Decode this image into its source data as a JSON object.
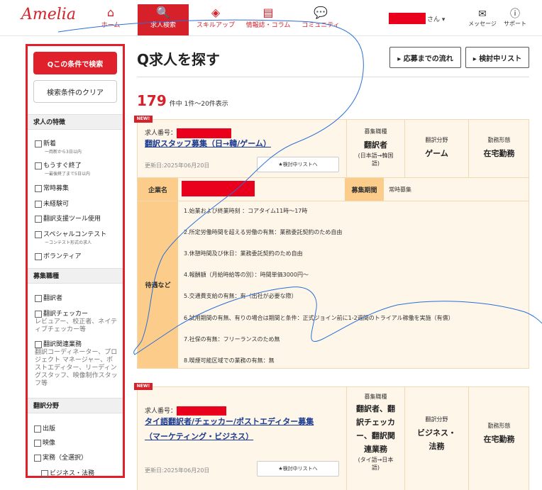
{
  "header": {
    "logo": "Amelia",
    "nav": [
      {
        "label": "ホーム",
        "icon": "home-icon",
        "glyph": "⌂"
      },
      {
        "label": "求人検索",
        "icon": "search-icon",
        "glyph": "🔍"
      },
      {
        "label": "スキルアップ",
        "icon": "layers-icon",
        "glyph": "◈"
      },
      {
        "label": "情報誌・コラム",
        "icon": "document-icon",
        "glyph": "▤"
      },
      {
        "label": "コミュニティ",
        "icon": "chat-icon",
        "glyph": "💬"
      }
    ],
    "user_suffix": "さん ▾",
    "message": {
      "label": "メッセージ",
      "glyph": "✉"
    },
    "support": {
      "label": "サポート",
      "glyph": "ⓘ"
    }
  },
  "sidebar": {
    "search_button": "Qこの条件で検索",
    "clear_button": "検索条件のクリア",
    "sections": [
      {
        "title": "求人の特徴"
      },
      {
        "title": "募集職種"
      },
      {
        "title": "翻訳分野"
      }
    ],
    "features": [
      {
        "label": "新着",
        "sub": "一両新から3日以内"
      },
      {
        "label": "もうすぐ終了",
        "sub": "一最後終了まで5日以内"
      },
      {
        "label": "常時募集",
        "sub": ""
      },
      {
        "label": "未経験可",
        "sub": ""
      },
      {
        "label": "翻訳支援ツール使用",
        "sub": ""
      },
      {
        "label": "スペシャルコンテスト",
        "sub": "ーコンテスト形式の求人"
      },
      {
        "label": "ボランティア",
        "sub": ""
      }
    ],
    "roles": [
      {
        "label": "翻訳者",
        "desc": ""
      },
      {
        "label": "翻訳チェッカー",
        "desc": "レビュアー、校正者、ネイティブチェッカー等"
      },
      {
        "label": "翻訳関連業務",
        "desc": "翻訳コーディネーター、プロジェクト マネージャー、ポストエディター、リーディングスタッフ、映像制作スタッフ等"
      }
    ],
    "fields": [
      {
        "label": "出版"
      },
      {
        "label": "映像"
      },
      {
        "label": "実務（全選択）"
      },
      {
        "label": "ビジネス・法務"
      }
    ]
  },
  "main": {
    "title": "Q求人を探す",
    "btn_flow": "▸ 応募までの流れ",
    "btn_list": "▸ 検討中リスト",
    "count_num": "179",
    "count_text": "件中 1件〜20件表示"
  },
  "jobs": [
    {
      "badge": "NEW!",
      "no_label": "求人番号：",
      "title_lines": [
        "翻訳スタッフ募集（日→韓/ゲーム）"
      ],
      "updated": "更新日:2025年06月20日",
      "fav": "★検討中リストへ",
      "role_label": "募集職種",
      "role_value": [
        "翻訳者"
      ],
      "role_sub": [
        "(日本語→韓国",
        "語)"
      ],
      "field_label": "翻訳分野",
      "field_value": [
        "ゲーム"
      ],
      "style_label": "勤務形態",
      "style_value": "在宅勤務",
      "company_label": "企業名",
      "period_label": "募集期間",
      "period_value": "常時募集",
      "terms_label": "待遇など",
      "terms": [
        "1.始業および終業時刻 ：コアタイム11時〜17時",
        "2.所定労働時間を超える労働の有無：業務委託契約のため自由",
        "3.休憩時間及び休日：業務委託契約のため自由",
        "4.報酬額（月給時給等の別）：時間単価3000円〜",
        "5.交通費支給の有無：有（出社が必要な際）",
        "6.試用期間の有無、有りの場合は期間と条件：正式ジョイン前に1-2週間のトライアル稼働を実施（有償）",
        "7.社保の有無：フリーランスのため無",
        "8.喫煙可能区域での業務の有無：無"
      ]
    },
    {
      "badge": "NEW!",
      "no_label": "求人番号：",
      "title_lines": [
        "タイ語翻訳者/チェッカー/ポストエディター募集",
        "（マーケティング・ビジネス）"
      ],
      "updated": "更新日:2025年06月20日",
      "fav": "★検討中リストへ",
      "role_label": "募集職種",
      "role_value": [
        "翻訳者、翻",
        "訳チェッカ",
        "ー、翻訳関",
        "連業務"
      ],
      "role_sub": [
        "(タイ語→日本",
        "語)"
      ],
      "field_label": "翻訳分野",
      "field_value": [
        "ビジネス・",
        "法務"
      ],
      "style_label": "勤務形態",
      "style_value": "在宅勤務"
    }
  ],
  "colors": {
    "accent": "#d6212b",
    "redact": "#e8001c",
    "card_bg": "#fff6ea",
    "label_bg": "#fccc8a",
    "link": "#1a3a8f"
  }
}
